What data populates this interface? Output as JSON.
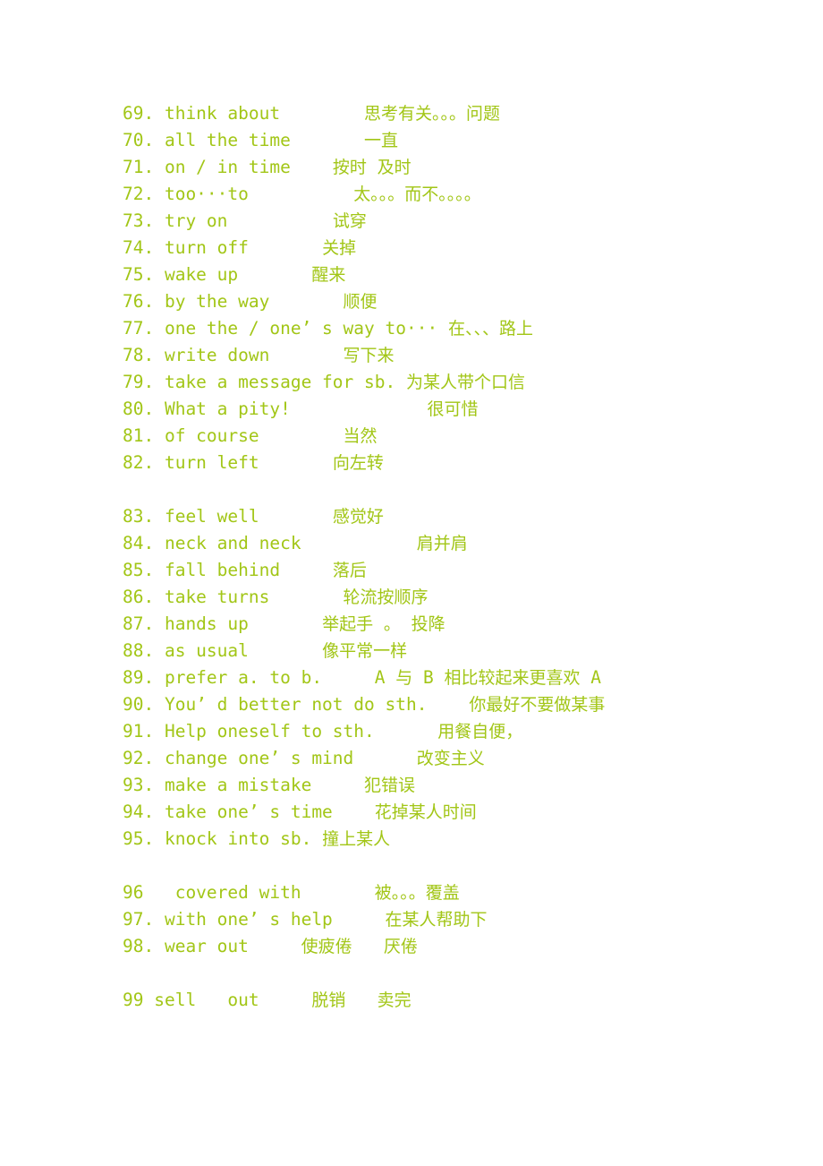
{
  "document": {
    "text_color": "#a2c617",
    "background_color": "#ffffff",
    "lines": [
      {
        "id": "line-69",
        "text": "69. think about        思考有关。。。问题"
      },
      {
        "id": "line-70",
        "text": "70. all the time       一直"
      },
      {
        "id": "line-71",
        "text": "71. on / in time    按时 及时"
      },
      {
        "id": "line-72",
        "text": "72. too···to          太。。。而不。。。。"
      },
      {
        "id": "line-73",
        "text": "73. try on          试穿"
      },
      {
        "id": "line-74",
        "text": "74. turn off       关掉"
      },
      {
        "id": "line-75",
        "text": "75. wake up       醒来"
      },
      {
        "id": "line-76",
        "text": "76. by the way       顺便"
      },
      {
        "id": "line-77",
        "text": "77. one the / one’ s way to··· 在、、、路上"
      },
      {
        "id": "line-78",
        "text": "78. write down       写下来"
      },
      {
        "id": "line-79",
        "text": "79. take a message for sb. 为某人带个口信"
      },
      {
        "id": "line-80",
        "text": "80. What a pity!             很可惜"
      },
      {
        "id": "line-81",
        "text": "81. of course        当然"
      },
      {
        "id": "line-82",
        "text": "82. turn left       向左转"
      },
      {
        "id": "line-gap-1",
        "text": ""
      },
      {
        "id": "line-83",
        "text": "83. feel well       感觉好"
      },
      {
        "id": "line-84",
        "text": "84. neck and neck           肩并肩"
      },
      {
        "id": "line-85",
        "text": "85. fall behind     落后"
      },
      {
        "id": "line-86",
        "text": "86. take turns       轮流按顺序"
      },
      {
        "id": "line-87",
        "text": "87. hands up       举起手 。 投降"
      },
      {
        "id": "line-88",
        "text": "88. as usual       像平常一样"
      },
      {
        "id": "line-89",
        "text": "89. prefer a. to b.     A 与 B 相比较起来更喜欢 A"
      },
      {
        "id": "line-90",
        "text": "90. You’ d better not do sth.    你最好不要做某事"
      },
      {
        "id": "line-91",
        "text": "91. Help oneself to sth.      用餐自便，"
      },
      {
        "id": "line-92",
        "text": "92. change one’ s mind      改变主义"
      },
      {
        "id": "line-93",
        "text": "93. make a mistake     犯错误"
      },
      {
        "id": "line-94",
        "text": "94. take one’ s time    花掉某人时间"
      },
      {
        "id": "line-95",
        "text": "95. knock into sb. 撞上某人"
      },
      {
        "id": "line-gap-2",
        "text": ""
      },
      {
        "id": "line-96",
        "text": "96   covered with       被。。。覆盖"
      },
      {
        "id": "line-97",
        "text": "97. with one’ s help     在某人帮助下"
      },
      {
        "id": "line-98",
        "text": "98. wear out     使疲倦   厌倦"
      },
      {
        "id": "line-gap-3",
        "text": ""
      },
      {
        "id": "line-99",
        "text": "99 sell   out     脱销   卖完"
      }
    ]
  }
}
